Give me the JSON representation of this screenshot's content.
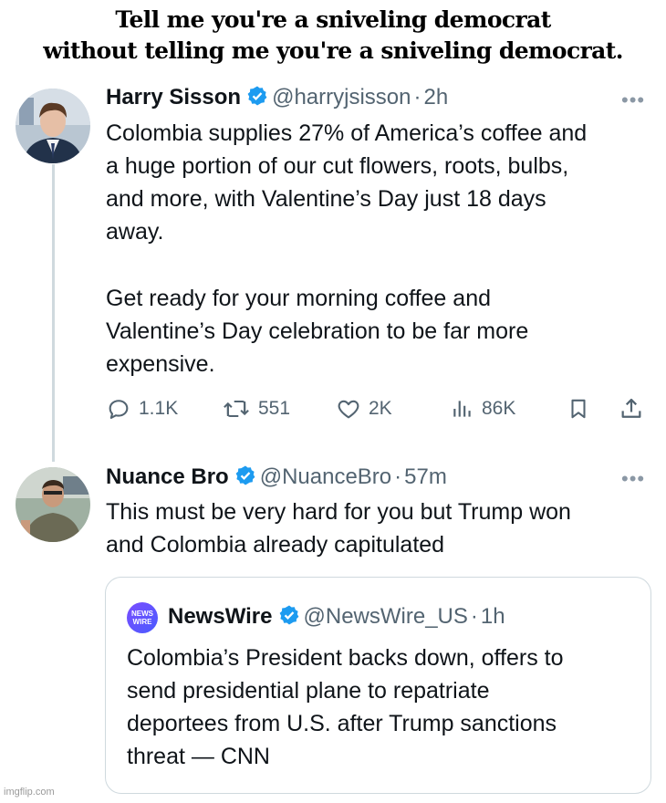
{
  "meme_caption": {
    "line1": "Tell me you're a sniveling democrat",
    "line2": "without telling me you're a sniveling democrat."
  },
  "tweet1": {
    "name": "Harry Sisson",
    "handle": "@harryjsisson",
    "time": "2h",
    "verified_color": "#1d9bf0",
    "body_lines": [
      "Colombia supplies 27% of America’s coffee and",
      "a huge portion of our cut flowers, roots, bulbs,",
      "and more, with Valentine’s Day just 18 days",
      "away."
    ],
    "body_lines_2": [
      "Get ready for your morning coffee and",
      "Valentine’s Day celebration to be far more",
      "expensive."
    ],
    "actions": {
      "replies": "1.1K",
      "retweets": "551",
      "likes": "2K",
      "views": "86K"
    }
  },
  "tweet2": {
    "name": "Nuance Bro",
    "handle": "@NuanceBro",
    "time": "57m",
    "body_lines": [
      "This must be very hard for you but Trump won",
      "and Colombia already capitulated"
    ]
  },
  "quoted_tweet": {
    "logo_text_1": "NEWS",
    "logo_text_2": "WIRE",
    "name": "NewsWire",
    "handle": "@NewsWire_US",
    "time": "1h",
    "body_lines": [
      "Colombia’s President backs down, offers to",
      "send presidential plane to repatriate",
      "deportees from U.S. after Trump sanctions",
      "threat — CNN"
    ]
  },
  "separator": "·",
  "more_glyph": "•••",
  "watermark": "imgflip.com"
}
